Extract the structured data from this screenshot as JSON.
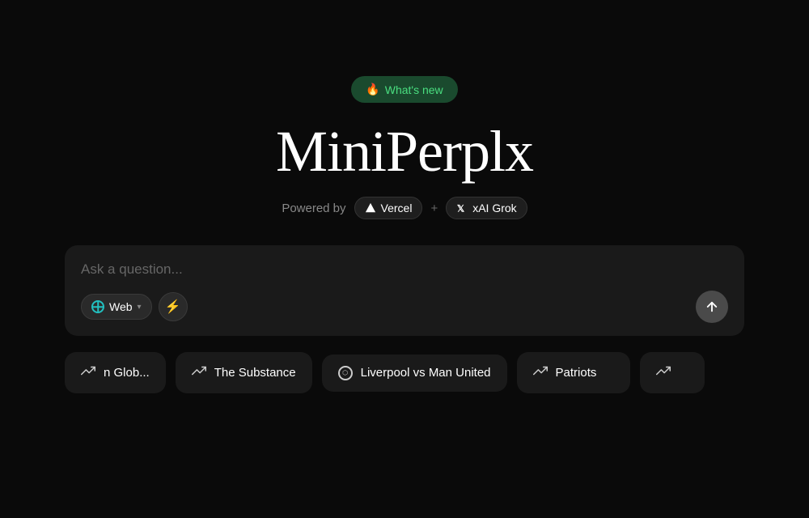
{
  "whats_new": {
    "label": "What's new",
    "icon": "🔥"
  },
  "app": {
    "title": "MiniPerplx",
    "powered_by_label": "Powered by"
  },
  "badges": {
    "vercel": {
      "label": "Vercel",
      "icon": "vercel-triangle"
    },
    "plus": "+",
    "xai": {
      "label": "xAI Grok",
      "icon": "xai-logo"
    }
  },
  "search": {
    "placeholder": "Ask a question...",
    "web_label": "Web",
    "submit_icon": "arrow-up-icon"
  },
  "trending": {
    "items": [
      {
        "id": "glob",
        "label": "n Glob...",
        "icon_type": "trend-up",
        "partial": "left"
      },
      {
        "id": "substance",
        "label": "The Substance",
        "icon_type": "trend-up"
      },
      {
        "id": "liverpool",
        "label": "Liverpool vs Man United",
        "icon_type": "soccer"
      },
      {
        "id": "patriots",
        "label": "Patriots",
        "icon_type": "trend-up"
      },
      {
        "id": "more",
        "label": "",
        "icon_type": "trend-up",
        "partial": "right"
      }
    ]
  },
  "colors": {
    "background": "#0a0a0a",
    "card_bg": "#1a1a1a",
    "accent_green": "#4ade80",
    "accent_teal": "#22c0c0",
    "text_primary": "#ffffff",
    "text_muted": "#888888"
  }
}
